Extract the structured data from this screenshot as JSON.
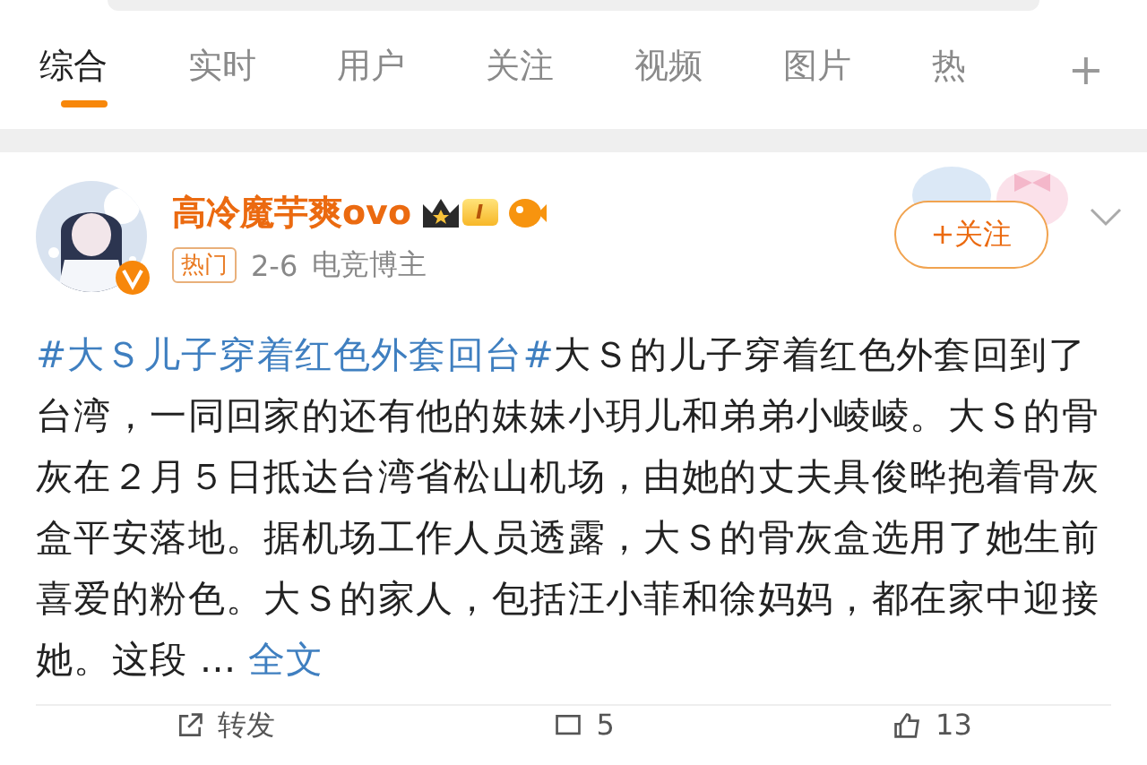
{
  "tabs": [
    {
      "label": "综合",
      "selected": true
    },
    {
      "label": "实时",
      "selected": false
    },
    {
      "label": "用户",
      "selected": false
    },
    {
      "label": "关注",
      "selected": false
    },
    {
      "label": "视频",
      "selected": false
    },
    {
      "label": "图片",
      "selected": false
    },
    {
      "label": "热",
      "selected": false
    }
  ],
  "add_tab": "+",
  "post": {
    "author": "高冷魔芋爽ovo",
    "level_badge": "I",
    "tag": "热门",
    "date": "2-6",
    "author_title": "电竞博主",
    "follow_button": "+关注",
    "hashtag": "#大Ｓ儿子穿着红色外套回台#",
    "body": "大Ｓ的儿子穿着红色外套回到了台湾，一同回家的还有他的妹妹小玥儿和弟弟小崚崚。大Ｓ的骨灰在２月５日抵达台湾省松山机场，由她的丈夫具俊晔抱着骨灰盒平安落地。据机场工作人员透露，大Ｓ的骨灰盒选用了她生前喜爱的粉色。大Ｓ的家人，包括汪小菲和徐妈妈，都在家中迎接她。这段 ...",
    "more_link": "全文",
    "actions": [
      {
        "kind": "repost",
        "label": "转发"
      },
      {
        "kind": "comment",
        "label": "5"
      },
      {
        "kind": "like",
        "label": "13"
      }
    ]
  }
}
